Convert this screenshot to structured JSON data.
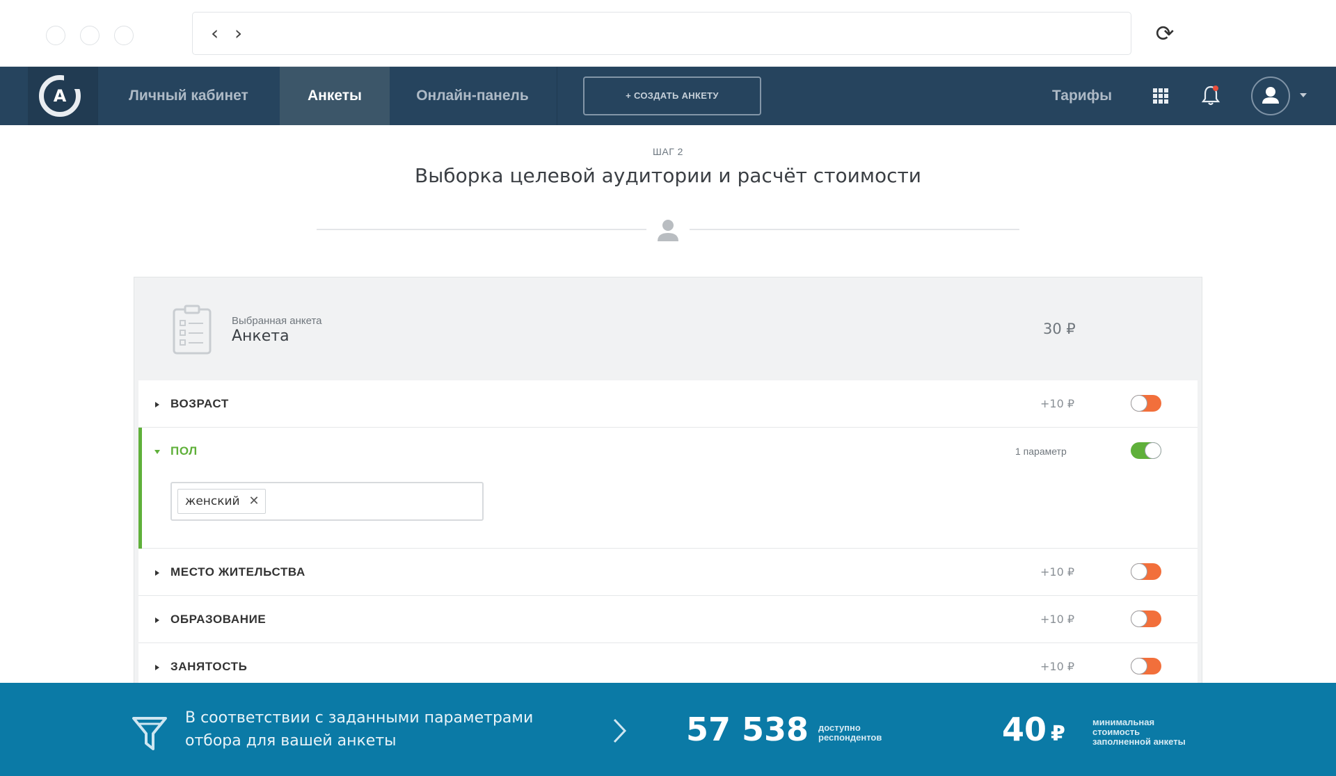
{
  "browser": {
    "back_glyph": "‹",
    "forward_glyph": "›",
    "reload_glyph": "⟳"
  },
  "nav": {
    "logo_letter": "A",
    "items": [
      {
        "label": "Личный кабинет"
      },
      {
        "label": "Анкеты",
        "active": true
      },
      {
        "label": "Онлайн-панель"
      }
    ],
    "create_button": "+ СОЗДАТЬ АНКЕТУ",
    "tariffs": "Тарифы",
    "icons": [
      "apps-grid-icon",
      "bell-icon",
      "user-icon"
    ]
  },
  "header": {
    "step": "ШАГ 2",
    "title": "Выборка целевой аудитории и расчёт стоимости"
  },
  "selected": {
    "caption": "Выбранная анкета",
    "name": "Анкета",
    "price": "30 ₽"
  },
  "filters": [
    {
      "label": "ВОЗРАСТ",
      "price": "+10 ₽",
      "enabled": false
    },
    {
      "label": "ПОЛ",
      "meta": "1 параметр",
      "enabled": true,
      "expanded": true,
      "tags": [
        "женский"
      ]
    },
    {
      "label": "МЕСТО ЖИТЕЛЬСТВА",
      "price": "+10 ₽",
      "enabled": false
    },
    {
      "label": "ОБРАЗОВАНИЕ",
      "price": "+10 ₽",
      "enabled": false
    },
    {
      "label": "ЗАНЯТОСТЬ",
      "price": "+10 ₽",
      "enabled": false
    }
  ],
  "banner": {
    "text_line1": "В соответствии с заданными параметрами",
    "text_line2": "отбора для вашей анкеты",
    "respondents_count": "57 538",
    "respondents_caption_1": "доступно",
    "respondents_caption_2": "респондентов",
    "min_price": "40",
    "currency": "₽",
    "price_caption_1": "минимальная",
    "price_caption_2": "стоимость",
    "price_caption_3": "заполненной анкеты"
  },
  "colors": {
    "nav_bg": "#26445e",
    "banner_bg": "#0b7aa6",
    "toggle_off": "#f26f3b",
    "toggle_on": "#5fb03a",
    "accent_green": "#5fb03a"
  }
}
